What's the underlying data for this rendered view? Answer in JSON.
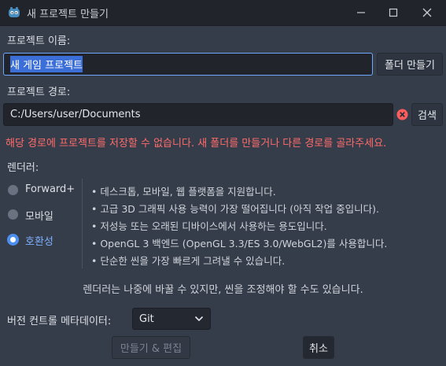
{
  "window": {
    "title": "새 프로젝트 만들기",
    "icon": "godot-icon",
    "controls": {
      "minimize": "—",
      "maximize": "☐",
      "close": "✕"
    }
  },
  "project_name": {
    "label": "프로젝트 이름:",
    "value": "새 게임 프로젝트",
    "create_folder_button": "폴더 만들기"
  },
  "project_path": {
    "label": "프로젝트 경로:",
    "value": "C:/Users/user/Documents",
    "status_icon": "error-icon",
    "browse_button": "검색"
  },
  "error_message": "해당 경로에 프로젝트를 저장할 수 없습니다. 새 폴더를 만들거나 다른 경로를 골라주세요.",
  "renderer": {
    "label": "렌더러:",
    "options": [
      {
        "label": "Forward+",
        "selected": false
      },
      {
        "label": "모바일",
        "selected": false
      },
      {
        "label": "호환성",
        "selected": true
      }
    ],
    "features": [
      "•  데스크톱, 모바일, 웹 플랫폼을 지원합니다.",
      "•  고급 3D 그래픽 사용 능력이 가장 떨어집니다 (아직 작업 중입니다).",
      "•  저성능 또는 오래된 디바이스에서 사용하는 용도입니다.",
      "•  OpenGL 3 백엔드 (OpenGL 3.3/ES 3.0/WebGL2)를 사용합니다.",
      "•  단순한 씬을 가장 빠르게 그려낼 수 있습니다."
    ],
    "note": "렌더러는 나중에 바꿀 수 있지만, 씬을 조정해야 할 수도 있습니다."
  },
  "vcs": {
    "label": "버전 컨트롤 메타데이터:",
    "selected": "Git"
  },
  "footer": {
    "create_button": "만들기 & 편집",
    "cancel_button": "취소"
  },
  "colors": {
    "background": "#363d4a",
    "accent": "#4d8ff0",
    "error": "#ff6b6b"
  }
}
